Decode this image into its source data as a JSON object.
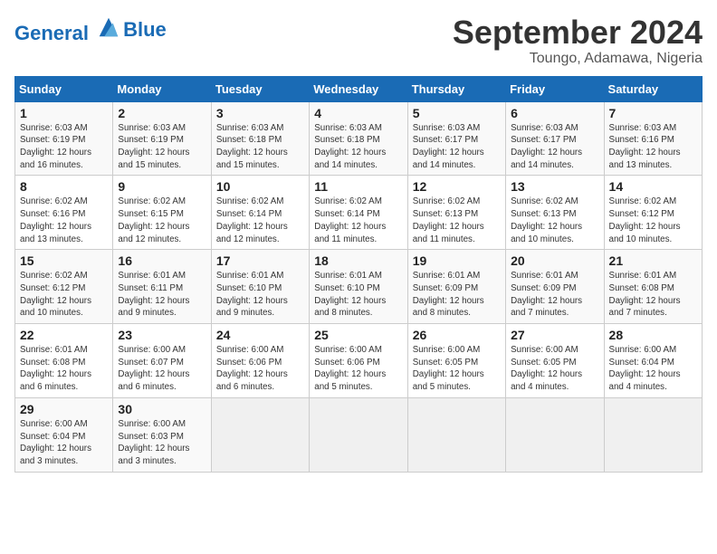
{
  "header": {
    "logo_line1": "General",
    "logo_line2": "Blue",
    "month": "September 2024",
    "location": "Toungo, Adamawa, Nigeria"
  },
  "columns": [
    "Sunday",
    "Monday",
    "Tuesday",
    "Wednesday",
    "Thursday",
    "Friday",
    "Saturday"
  ],
  "weeks": [
    [
      {
        "day": "1",
        "sunrise": "6:03 AM",
        "sunset": "6:19 PM",
        "daylight": "12 hours and 16 minutes."
      },
      {
        "day": "2",
        "sunrise": "6:03 AM",
        "sunset": "6:19 PM",
        "daylight": "12 hours and 15 minutes."
      },
      {
        "day": "3",
        "sunrise": "6:03 AM",
        "sunset": "6:18 PM",
        "daylight": "12 hours and 15 minutes."
      },
      {
        "day": "4",
        "sunrise": "6:03 AM",
        "sunset": "6:18 PM",
        "daylight": "12 hours and 14 minutes."
      },
      {
        "day": "5",
        "sunrise": "6:03 AM",
        "sunset": "6:17 PM",
        "daylight": "12 hours and 14 minutes."
      },
      {
        "day": "6",
        "sunrise": "6:03 AM",
        "sunset": "6:17 PM",
        "daylight": "12 hours and 14 minutes."
      },
      {
        "day": "7",
        "sunrise": "6:03 AM",
        "sunset": "6:16 PM",
        "daylight": "12 hours and 13 minutes."
      }
    ],
    [
      {
        "day": "8",
        "sunrise": "6:02 AM",
        "sunset": "6:16 PM",
        "daylight": "12 hours and 13 minutes."
      },
      {
        "day": "9",
        "sunrise": "6:02 AM",
        "sunset": "6:15 PM",
        "daylight": "12 hours and 12 minutes."
      },
      {
        "day": "10",
        "sunrise": "6:02 AM",
        "sunset": "6:14 PM",
        "daylight": "12 hours and 12 minutes."
      },
      {
        "day": "11",
        "sunrise": "6:02 AM",
        "sunset": "6:14 PM",
        "daylight": "12 hours and 11 minutes."
      },
      {
        "day": "12",
        "sunrise": "6:02 AM",
        "sunset": "6:13 PM",
        "daylight": "12 hours and 11 minutes."
      },
      {
        "day": "13",
        "sunrise": "6:02 AM",
        "sunset": "6:13 PM",
        "daylight": "12 hours and 10 minutes."
      },
      {
        "day": "14",
        "sunrise": "6:02 AM",
        "sunset": "6:12 PM",
        "daylight": "12 hours and 10 minutes."
      }
    ],
    [
      {
        "day": "15",
        "sunrise": "6:02 AM",
        "sunset": "6:12 PM",
        "daylight": "12 hours and 10 minutes."
      },
      {
        "day": "16",
        "sunrise": "6:01 AM",
        "sunset": "6:11 PM",
        "daylight": "12 hours and 9 minutes."
      },
      {
        "day": "17",
        "sunrise": "6:01 AM",
        "sunset": "6:10 PM",
        "daylight": "12 hours and 9 minutes."
      },
      {
        "day": "18",
        "sunrise": "6:01 AM",
        "sunset": "6:10 PM",
        "daylight": "12 hours and 8 minutes."
      },
      {
        "day": "19",
        "sunrise": "6:01 AM",
        "sunset": "6:09 PM",
        "daylight": "12 hours and 8 minutes."
      },
      {
        "day": "20",
        "sunrise": "6:01 AM",
        "sunset": "6:09 PM",
        "daylight": "12 hours and 7 minutes."
      },
      {
        "day": "21",
        "sunrise": "6:01 AM",
        "sunset": "6:08 PM",
        "daylight": "12 hours and 7 minutes."
      }
    ],
    [
      {
        "day": "22",
        "sunrise": "6:01 AM",
        "sunset": "6:08 PM",
        "daylight": "12 hours and 6 minutes."
      },
      {
        "day": "23",
        "sunrise": "6:00 AM",
        "sunset": "6:07 PM",
        "daylight": "12 hours and 6 minutes."
      },
      {
        "day": "24",
        "sunrise": "6:00 AM",
        "sunset": "6:06 PM",
        "daylight": "12 hours and 6 minutes."
      },
      {
        "day": "25",
        "sunrise": "6:00 AM",
        "sunset": "6:06 PM",
        "daylight": "12 hours and 5 minutes."
      },
      {
        "day": "26",
        "sunrise": "6:00 AM",
        "sunset": "6:05 PM",
        "daylight": "12 hours and 5 minutes."
      },
      {
        "day": "27",
        "sunrise": "6:00 AM",
        "sunset": "6:05 PM",
        "daylight": "12 hours and 4 minutes."
      },
      {
        "day": "28",
        "sunrise": "6:00 AM",
        "sunset": "6:04 PM",
        "daylight": "12 hours and 4 minutes."
      }
    ],
    [
      {
        "day": "29",
        "sunrise": "6:00 AM",
        "sunset": "6:04 PM",
        "daylight": "12 hours and 3 minutes."
      },
      {
        "day": "30",
        "sunrise": "6:00 AM",
        "sunset": "6:03 PM",
        "daylight": "12 hours and 3 minutes."
      },
      null,
      null,
      null,
      null,
      null
    ]
  ]
}
